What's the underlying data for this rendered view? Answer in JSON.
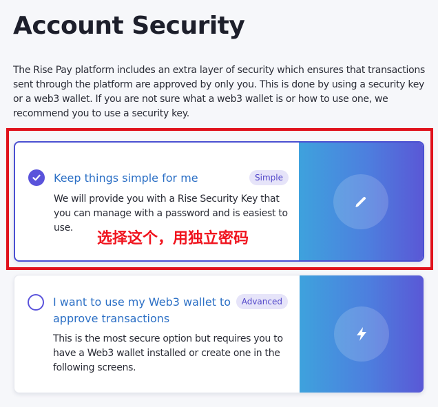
{
  "page": {
    "title": "Account Security",
    "intro": "The Rise Pay platform includes an extra layer of security which ensures that transactions sent through the platform are approved by only you. This is done by using a security key or a web3 wallet. If you are not sure what a web3 wallet is or how to use one, we recommend you to use a security key."
  },
  "options": [
    {
      "title": "Keep things simple for me",
      "badge": "Simple",
      "description": "We will provide you with a Rise Security Key that you can manage with a password and is easiest to use.",
      "selected": true,
      "icon": "pen-icon"
    },
    {
      "title": "I want to use my Web3 wallet to approve transactions",
      "badge": "Advanced",
      "description": "This is the most secure option but requires you to have a Web3 wallet installed or create one in the following screens.",
      "selected": false,
      "icon": "lightning-icon"
    }
  ],
  "annotation": {
    "text": "选择这个，用独立密码"
  },
  "colors": {
    "accent": "#5a53db",
    "title_blue": "#2b6fc5",
    "annotation_red": "#e0121c",
    "gradient_start": "#3ea2dd",
    "gradient_end": "#5a58d6"
  }
}
